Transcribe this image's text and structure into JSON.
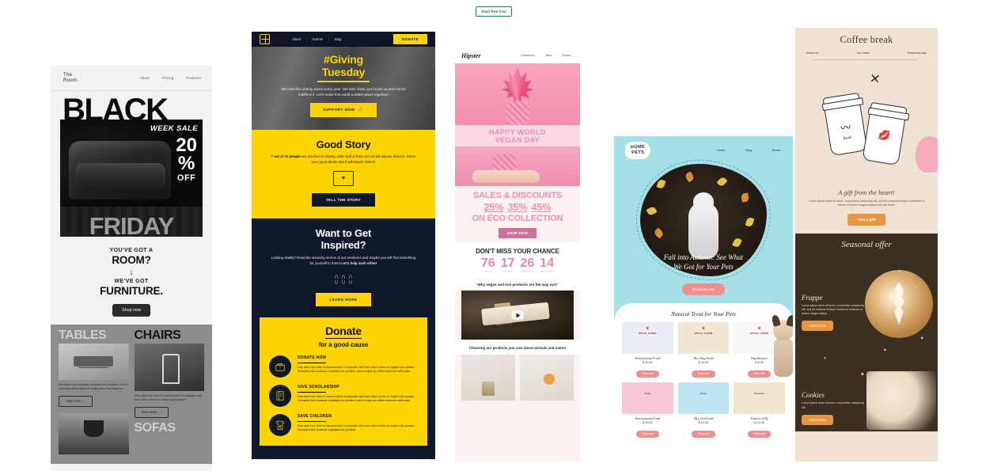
{
  "topbar": {
    "trial_button": "Start free trial"
  },
  "templates": [
    {
      "id": "black-friday",
      "name": "The Room - Black Friday",
      "logo_line1": "The",
      "logo_line2": "Room",
      "nav": [
        "About",
        "Pricing",
        "Products"
      ],
      "hero_word": "BLACK",
      "hero_sub": "WEEK SALE",
      "discount_number": "20",
      "discount_percent": "%",
      "discount_off": "OFF",
      "hero_bottom": "FRIDAY",
      "mid_line1": "YOU'VE GOT A",
      "mid_line2": "ROOM?",
      "mid_arrow": "↓",
      "mid_line3": "WE'VE GOT",
      "mid_line4": "FURNITURE.",
      "shop_button": "Shop now",
      "cat1_title": "TABLES",
      "cat2_title": "CHAIRS",
      "cat3_title": "SOFAS",
      "cat1_body": "Excepteur sint occaecat cupidatat non proident, sunt in culpa qui officia deserunt mollit anim id est laborum.",
      "cat2_body": "Duis aute irure dolor in reprehenderit in voluptate velit esse cillum dolore eu fugiat nulla pariatur.",
      "view_more": "View more →"
    },
    {
      "id": "giving-tuesday",
      "name": "Giving Tuesday charity",
      "nav": [
        "About",
        "Events",
        "Blog"
      ],
      "nav_separator": "|",
      "donate_button": "DONATE",
      "hero_title_line1": "#Giving",
      "hero_title_line2": "Tuesday",
      "hero_body": "We hold this charity event every year. We also invite you to join us and not be indifferent. Let's make this world a better place together!",
      "hero_button": "SUPPORT NOW",
      "hero_button_icon": "✍",
      "story_title": "Good Story",
      "story_body_bold": "7 out of 10 people",
      "story_body": " are involved in charity, while half of them do not tell anyone about it. Share your good deeds and it will inspire others!",
      "story_icon": "envelope-heart-icon",
      "story_button": "TELL THE STORY",
      "inspired_title_line1": "Want to Get",
      "inspired_title_line2": "Inspired?",
      "inspired_body": "Lacking vitality? Read the amazing stories of our members and maybe you will find something for yourself in them! ",
      "inspired_body_bold": "Let's help each other!",
      "inspired_icon": "praying-hands-icon",
      "inspired_button": "LEARN MORE",
      "donate_title": "Donate",
      "donate_subtitle": "for a good cause",
      "donate_items": [
        {
          "icon": "donation-box-icon",
          "title": "DONATE NOW",
          "body": "Duis aute irure dolor in reprehenderit in voluptate velit esse cillum dolore eu fugiat nulla pariatur. Excepteur sint occaecat cupidatat non proident, sunt in culpa qui officia deserunt mollit anim."
        },
        {
          "icon": "book-icon",
          "title": "GIVE SCHOLARSHIP",
          "body": "Duis aute irure dolor in reprehenderit in voluptate velit esse cillum dolore eu fugiat nulla pariatur. Excepteur sint occaecat cupidatat non proident, sunt in culpa qui officia deserunt mollit anim."
        },
        {
          "icon": "tshirt-heart-icon",
          "title": "SAVE CHILDREN",
          "body": "Duis aute irure dolor in reprehenderit in voluptate velit esse cillum dolore eu fugiat nulla pariatur. Excepteur sint occaecat cupidatat non proident,"
        }
      ]
    },
    {
      "id": "hipster-vegan",
      "name": "Hipster - World Vegan Day",
      "logo": "Hipster",
      "nav": [
        "Collections",
        "New",
        "Brand"
      ],
      "band_line1": "HAPPY WORLD",
      "band_line2": "VEGAN DAY",
      "sales_line": "SALES & DISCOUNTS",
      "percents": [
        "25%",
        "35%",
        "45%"
      ],
      "eco_line": "ON ECO COLLECTION",
      "shop_button": "SHOP NOW",
      "chance_title": "DON'T MISS YOUR CHANCE",
      "countdown": [
        {
          "value": "76",
          "unit": "DAYS"
        },
        {
          "value": "17",
          "unit": "HOURS"
        },
        {
          "value": "26",
          "unit": "MINUTES"
        },
        {
          "value": "14",
          "unit": "SECONDS"
        }
      ],
      "question": "Why vegan and eco products are the way out?",
      "video_icon": "play-button-icon",
      "care_line": "Choosing our products you care about animals and nature"
    },
    {
      "id": "home-pets",
      "name": "Home Pets autumn",
      "logo_line1": "HOME",
      "logo_line2": "PETS",
      "nav": [
        "Home",
        "Blog",
        "Brand"
      ],
      "script_line1": "Fall into Autumn: See What",
      "script_line2": "We Got for Your Pets",
      "cta_button": "Shopping now",
      "section_title": "Natural Treat for Your Pets",
      "products": [
        {
          "brand": "ROYAL CANIN",
          "name": "Veterinarian Food",
          "price": "$ 11.99",
          "button": "Shop now",
          "color": "#e9eef4"
        },
        {
          "brand": "ROYAL CANIN",
          "name": "Dry Dog Food",
          "price": "$ 14.99",
          "button": "Shop now",
          "color": "#f0e6d2"
        },
        {
          "brand": "ROYAL CANIN",
          "name": "Pup Booster",
          "price": "$ 8.99",
          "button": "Shop now",
          "color": "#f6f6f6"
        },
        {
          "brand": "Kitty",
          "name": "Veterinarian Food",
          "price": "$ 20.99",
          "button": "Shop now",
          "color": "#f7c9d6"
        },
        {
          "brand": "Kitty",
          "name": "Dry Cat Food",
          "price": "$ 14.99",
          "button": "Shop now",
          "color": "#bfe4f2"
        },
        {
          "brand": "Nourish",
          "name": "Tuna in Jelly",
          "price": "$ 10.99",
          "button": "Shop now",
          "color": "#efe6cf"
        }
      ]
    },
    {
      "id": "coffee-break",
      "name": "Coffee break",
      "title": "Coffee break",
      "nav": [
        "About us",
        "Our store",
        "Download app"
      ],
      "cup_left_icon": "moustache-icon",
      "cup_left_word": "love",
      "cup_right_icon": "lips-icon",
      "gift_title": "A gift from the heart!",
      "gift_body": "Lorem ipsum dolor sit amet, consectetur adipiscing elit, sed do eiusmod tempor incididunt ut labore et dolore magna aliqua.from the heart!",
      "gift_button": "Take a gift!",
      "seasonal_title": "Seasonal offer",
      "offers": [
        {
          "title": "Frappe",
          "body": "Lorem ipsum dolor sit amet, consectetur adipiscing elit, sed do eiusmod tempor incididunt ut labore et dolore magna aliqua.",
          "button": "Learn more"
        },
        {
          "title": "Cookies",
          "body": "Lorem ipsum dolor sit amet, consectetur adipiscing elit,",
          "button": "Learn more"
        }
      ]
    }
  ]
}
